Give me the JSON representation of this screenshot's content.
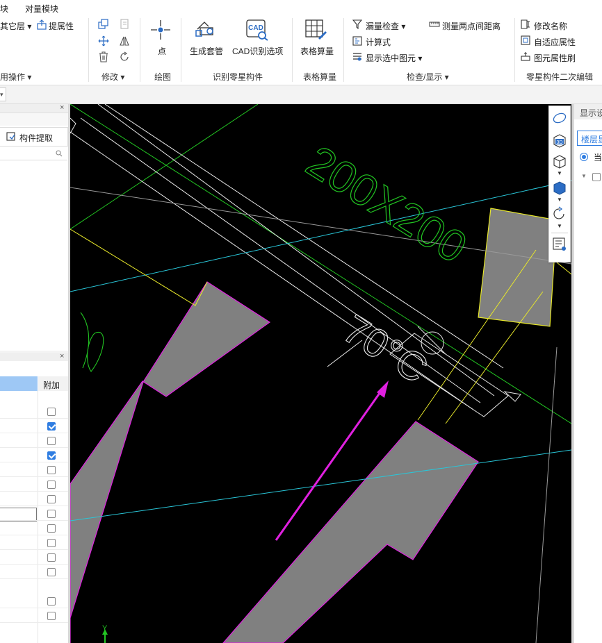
{
  "menu": {
    "item1": "块",
    "item2": "对量模块"
  },
  "ribbon": {
    "other_layer": "其它层",
    "extract_attr": "提属性",
    "common_ops_group": "用操作",
    "modify_group": "修改",
    "point_label": "点",
    "draw_group": "绘图",
    "gen_sleeve": "生成套管",
    "cad_options": "CAD识别选项",
    "identify_group": "识别零星构件",
    "table_calc": "表格算量",
    "table_calc_group": "表格算量",
    "leak_check": "漏量检查",
    "measure_distance": "测量两点间距离",
    "formula": "计算式",
    "show_selected": "显示选中图元",
    "check_display_group": "检查/显示",
    "rename": "修改名称",
    "adaptive_attr": "自适应属性",
    "attr_brush": "图元属性刷",
    "secondary_edit_group": "零星构件二次编辑"
  },
  "left_panel": {
    "extract_component": "构件提取",
    "attach_header": "附加",
    "checkboxes": [
      false,
      true,
      false,
      true,
      false,
      false,
      false,
      false,
      false,
      false,
      false,
      false,
      false,
      false
    ]
  },
  "right_panel": {
    "title": "显示设",
    "tab": "楼层显",
    "radio_label": "当"
  },
  "canvas": {
    "dimension_text": "200X200",
    "elevation_text": "70°C",
    "axis_y": "Y"
  },
  "colors": {
    "canvas_bg": "#000000",
    "fill_gray": "#808080",
    "magenta": "#e020e0",
    "green": "#22c422",
    "cyan": "#29c6d8",
    "yellow": "#e6e62a",
    "white_line": "#e8e8e8",
    "accent_blue": "#2f7de1"
  },
  "icons": [
    "copy-icon",
    "move-icon",
    "delete-icon",
    "mirror-icon",
    "rotate-icon",
    "point-icon",
    "sleeve-icon",
    "cad-icon",
    "table-icon",
    "filter-icon",
    "ruler-icon",
    "formula-icon",
    "show-icon",
    "rename-icon",
    "adaptive-icon",
    "brush-icon",
    "orbit-icon",
    "3d-icon",
    "box-icon",
    "rotate-view-icon",
    "list-view-icon"
  ]
}
